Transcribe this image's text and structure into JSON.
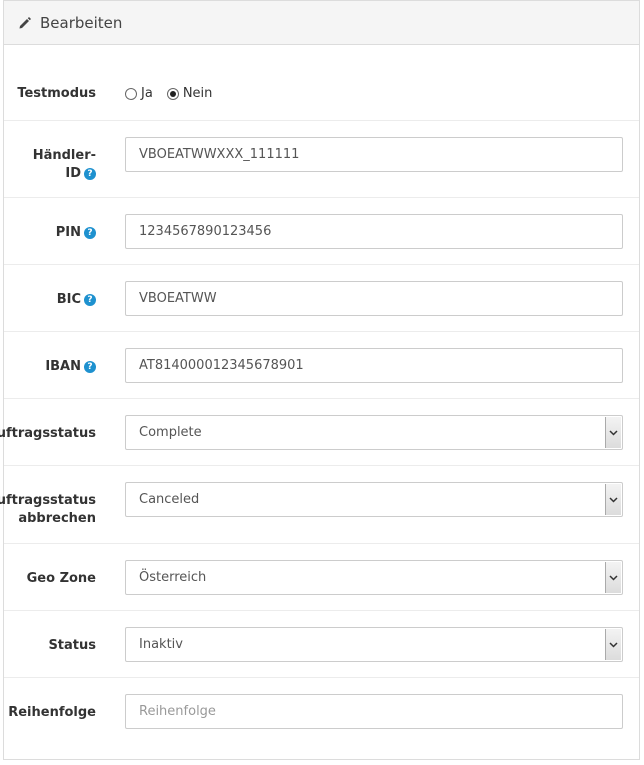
{
  "panel": {
    "title": "Bearbeiten"
  },
  "testmodus": {
    "label": "Testmodus",
    "options": [
      "Ja",
      "Nein"
    ],
    "selected": "Nein"
  },
  "merchant": {
    "label_line1": "Händler-",
    "label_line2": "ID",
    "value": "VBOEATWWXXX_111111"
  },
  "pin": {
    "label": "PIN",
    "value": "1234567890123456"
  },
  "bic": {
    "label": "BIC",
    "value": "VBOEATWW"
  },
  "iban": {
    "label": "IBAN",
    "value": "AT814000012345678901"
  },
  "order_status": {
    "label": "Auftragsstatus",
    "value": "Complete"
  },
  "cancel_status": {
    "label_line1": "Auftragsstatus",
    "label_line2": "abbrechen",
    "value": "Canceled"
  },
  "geo_zone": {
    "label": "Geo Zone",
    "value": "Österreich"
  },
  "status": {
    "label": "Status",
    "value": "Inaktiv"
  },
  "sort_order": {
    "label": "Reihenfolge",
    "value": "",
    "placeholder": "Reihenfolge"
  },
  "help_glyph": "?",
  "icons": {
    "panel_icon": "pencil-icon",
    "help_icon": "question-circle-icon",
    "select_arrow": "chevron-down-icon"
  }
}
